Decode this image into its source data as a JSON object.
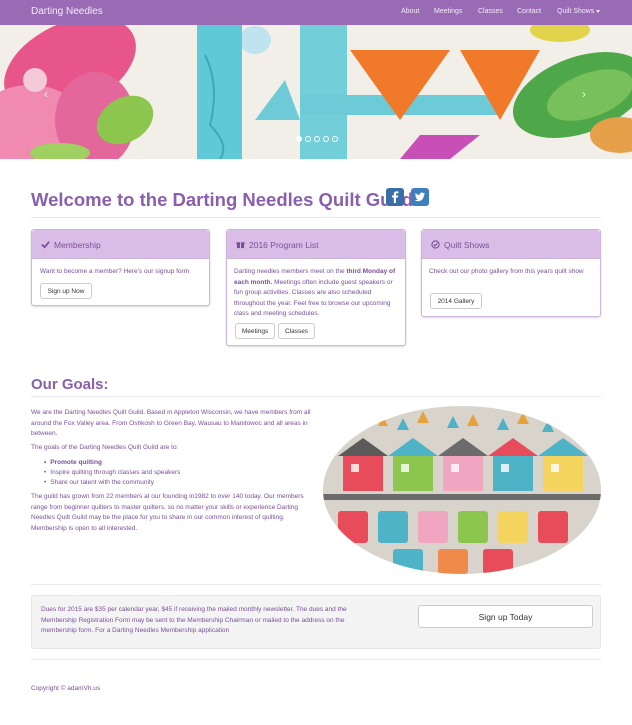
{
  "nav": {
    "brand": "Darting Needles",
    "links": [
      "About",
      "Meetings",
      "Classes",
      "Contact"
    ],
    "dropdown": "Quilt Shows"
  },
  "carousel": {
    "prev": "‹",
    "next": "›",
    "slide_count": 5,
    "active_slide": 1
  },
  "welcome": {
    "title": "Welcome to the Darting Needles Quilt Guild"
  },
  "panels": {
    "membership": {
      "title": "Membership",
      "text": "Want to become a member? Here's our signup form",
      "button": "Sign up Now"
    },
    "program": {
      "title": "2016 Program List",
      "text_pre": "Darting needles members meet on the ",
      "text_bold": "third Monday of each month.",
      "text_post": " Meetings often include guest speakers or fun group activities. Classes are also scheduled throughout the year. Feel free to browse our upcoming class and meeting schedules.",
      "button_meetings": "Meetings",
      "button_classes": "Classes"
    },
    "shows": {
      "title": "Quilt Shows",
      "text": "Check out our photo gallery from this years quilt show",
      "button": "2014 Gallery"
    }
  },
  "goals": {
    "title": "Our Goals:",
    "intro": "We are the Darting Needles Quilt Guild. Based in Appleton Wisconsin, we have members from all around the Fox Valley area. From Oshkosh to Green Bay, Wausau to Manitowoc and all areas in between.",
    "list_intro": "The goals of the Darting Needles Quilt Guild are to:",
    "items": [
      "Promote quilting",
      "Inspire quilting through classes and speakers",
      "Share our talent with the community"
    ],
    "growth": "The guild has grown from 22 members at our founding in1982 to over 140 today. Our members range from beginner quilters to master quilters, so no matter your skills or experience Darting Needles Quilt Guild may be the place for you to share in our common interest of quilting. Membership is open to all interested."
  },
  "dues": {
    "text": "Dues for 2015 are $35 per calendar year, $45 if receiving the mailed monthly newsletter. The dues and the Membership Registration Form may be sent to the Membership Chairman or mailed to the address on the membership form. For a Darting Needles Membership application",
    "button": "Sign up Today"
  },
  "footer": {
    "text": "Copyright © adamVh.us"
  },
  "colors": {
    "navbar": "#9a6bb5",
    "accent": "#8a5fad",
    "panel_header": "#d9bde6",
    "social": "#3a6ea8"
  }
}
